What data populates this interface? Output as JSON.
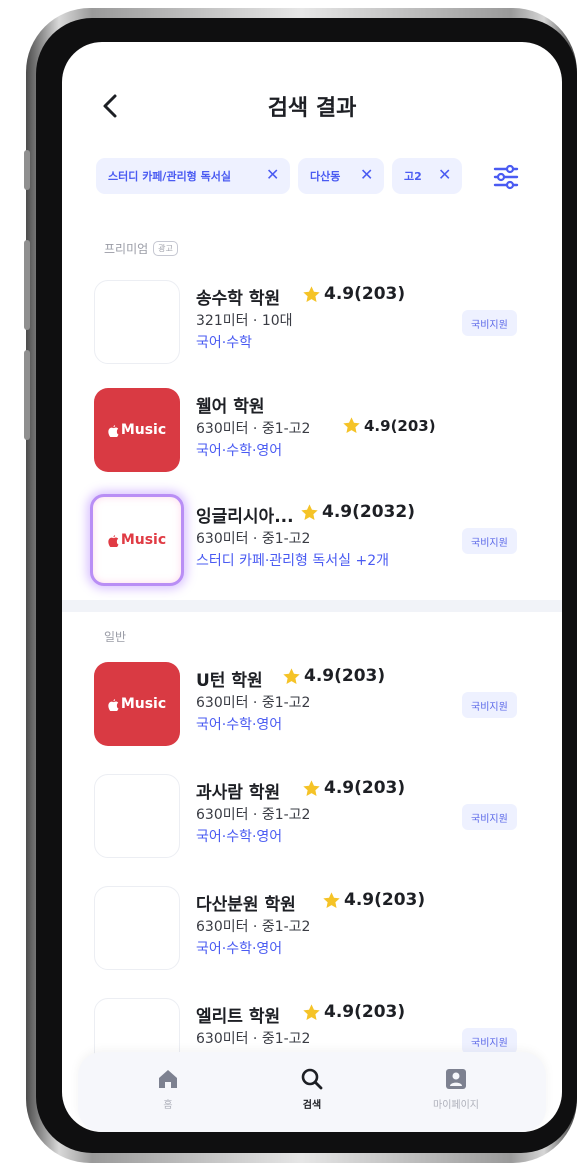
{
  "header": {
    "title": "검색 결과",
    "back_icon": "chevron-left-icon"
  },
  "filters": [
    {
      "label": "스터디 카페/관리형 독서실"
    },
    {
      "label": "다산동"
    },
    {
      "label": "고2"
    }
  ],
  "filter_icon": "sliders-icon",
  "premium": {
    "label": "프리미엄",
    "ad_badge": "광고",
    "items": [
      {
        "name": "송수학 학원",
        "rating": "4.9(203)",
        "meta": "321미터 · 10대",
        "tags": "국어·수학",
        "badge": "국비지원",
        "thumb": "blank"
      },
      {
        "name": "웰어 학원",
        "rating": "4.9(203)",
        "meta": "630미터 · 중1-고2",
        "tags": "국어·수학·영어",
        "badge": "",
        "thumb": "music"
      },
      {
        "name": "잉글리시아...",
        "rating": "4.9(2032)",
        "meta": "630미터 · 중1-고2",
        "tags": "스터디 카페·관리형 독서실 +2개",
        "badge": "국비지원",
        "thumb": "music-highlight"
      }
    ]
  },
  "general": {
    "label": "일반",
    "items": [
      {
        "name": "U턴 학원",
        "rating": "4.9(203)",
        "meta": "630미터 · 중1-고2",
        "tags": "국어·수학·영어",
        "badge": "국비지원",
        "thumb": "music"
      },
      {
        "name": "과사람 학원",
        "rating": "4.9(203)",
        "meta": "630미터 · 중1-고2",
        "tags": "국어·수학·영어",
        "badge": "국비지원",
        "thumb": "blank"
      },
      {
        "name": "다산분원 학원",
        "rating": "4.9(203)",
        "meta": "630미터 · 중1-고2",
        "tags": "국어·수학·영어",
        "badge": "",
        "thumb": "blank"
      },
      {
        "name": "엘리트 학원",
        "rating": "4.9(203)",
        "meta": "630미터 · 중1-고2",
        "tags": "",
        "badge": "국비지원",
        "thumb": "blank"
      }
    ]
  },
  "thumb_logo_text": "Music",
  "bottom_nav": [
    {
      "label": "홈",
      "icon": "home-icon",
      "active": false
    },
    {
      "label": "검색",
      "icon": "search-icon",
      "active": true
    },
    {
      "label": "마이페이지",
      "icon": "profile-icon",
      "active": false
    }
  ],
  "colors": {
    "accent": "#4a5bf2",
    "star": "#f5c327",
    "music_red": "#d93a43",
    "chip_bg": "#eef1ff"
  }
}
